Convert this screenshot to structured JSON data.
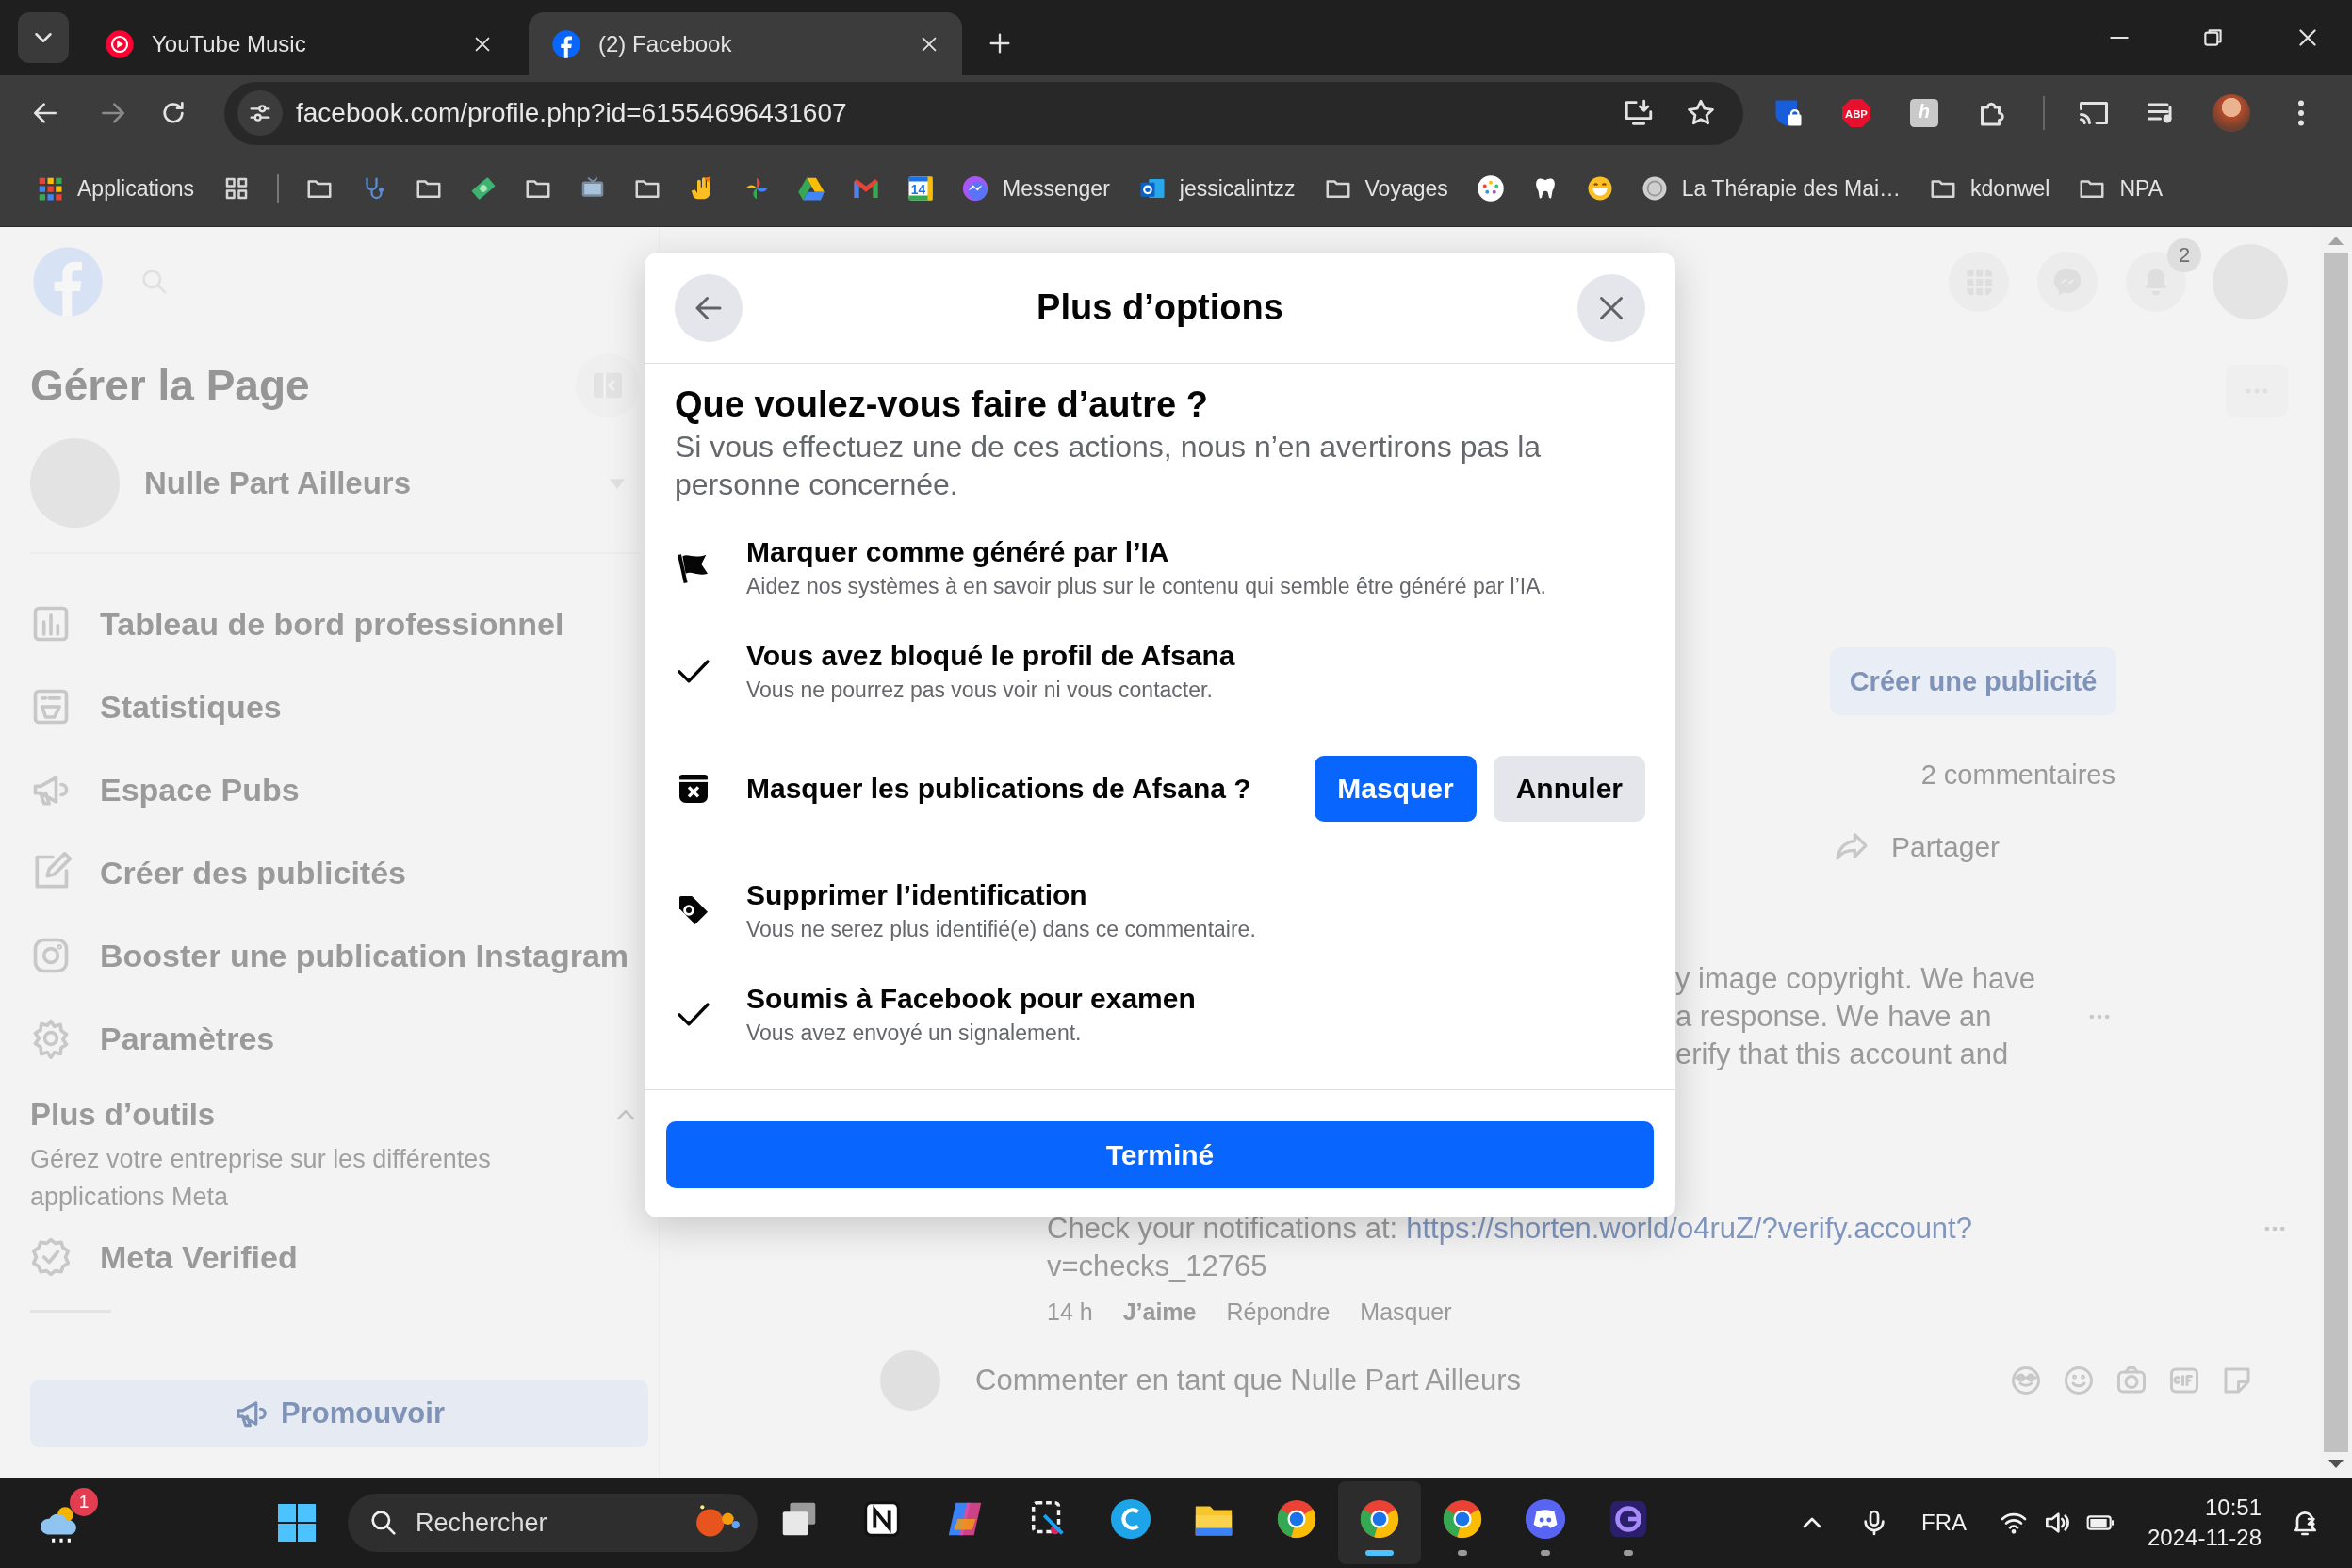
{
  "browser": {
    "tabs": [
      {
        "title": "YouTube Music",
        "selected": false
      },
      {
        "title": "(2) Facebook",
        "selected": true
      }
    ],
    "url": "facebook.com/profile.php?id=61554696431607",
    "extensions": [
      {
        "kind": "icon"
      },
      {
        "kind": "lettered",
        "label": "ABP"
      },
      {
        "kind": "lettered",
        "label": "h"
      },
      {
        "kind": "icon"
      }
    ],
    "bookmarks": [
      {
        "kind": "link",
        "label": "Applications"
      },
      {
        "kind": "link"
      },
      {
        "kind": "separator"
      },
      {
        "kind": "folder"
      },
      {
        "kind": "link"
      },
      {
        "kind": "folder"
      },
      {
        "kind": "link"
      },
      {
        "kind": "folder"
      },
      {
        "kind": "link"
      },
      {
        "kind": "folder"
      },
      {
        "kind": "link"
      },
      {
        "kind": "link"
      },
      {
        "kind": "link"
      },
      {
        "kind": "link"
      },
      {
        "kind": "link",
        "badge": "14"
      },
      {
        "kind": "link",
        "label": "Messenger"
      },
      {
        "kind": "link",
        "label": "jessicalintzz"
      },
      {
        "kind": "folder",
        "label": "Voyages"
      },
      {
        "kind": "link"
      },
      {
        "kind": "link"
      },
      {
        "kind": "link"
      },
      {
        "kind": "link",
        "label": "La Thérapie des Mai…"
      },
      {
        "kind": "folder",
        "label": "kdonwel"
      },
      {
        "kind": "folder",
        "label": "NPA"
      }
    ]
  },
  "page": {
    "notification_count": "2",
    "sidebar": {
      "title": "Gérer la Page",
      "page_name": "Nulle Part Ailleurs",
      "items": [
        {
          "label": "Tableau de bord professionnel"
        },
        {
          "label": "Statistiques"
        },
        {
          "label": "Espace Pubs"
        },
        {
          "label": "Créer des publicités"
        },
        {
          "label": "Booster une publication Instagram"
        },
        {
          "label": "Paramètres"
        }
      ],
      "more_tools": {
        "title": "Plus d’outils",
        "description": "Gérez votre entreprise sur les différentes applications Meta",
        "expanded": true,
        "items": [
          {
            "label": "Meta Verified"
          }
        ]
      },
      "promote": "Promouvoir"
    },
    "feed": {
      "create_ad": "Créer une publicité",
      "comment_count": "2 commentaires",
      "share": "Partager",
      "comment_fragments": [
        "y image copyright. We have",
        "a response. We have an",
        "erify that this account and"
      ],
      "comment": {
        "text": "Check your notifications at:",
        "link": "https://shorten.world/o4ruZ/?verify.account?",
        "link_rest": "v=checks_12765",
        "time": "14 h",
        "actions": [
          "J’aime",
          "Répondre",
          "Masquer"
        ]
      },
      "composer_placeholder": "Commenter en tant que Nulle Part Ailleurs"
    }
  },
  "dialog": {
    "title": "Plus d’options",
    "heading": "Que voulez-vous faire d’autre ?",
    "intro": "Si vous effectuez une de ces actions, nous n’en avertirons pas la personne concernée.",
    "options": [
      {
        "kind": "info",
        "title": "Marquer comme généré par l’IA",
        "subtitle": "Aidez nos systèmes à en savoir plus sur le contenu qui semble être généré par l’IA."
      },
      {
        "kind": "info",
        "title": "Vous avez bloqué le profil de Afsana",
        "subtitle": "Vous ne pourrez pas vous voir ni vous contacter."
      },
      {
        "kind": "confirm",
        "title": "Masquer les publications de Afsana ?",
        "buttons": [
          {
            "label": "Masquer",
            "primary": true
          },
          {
            "label": "Annuler",
            "primary": false
          }
        ]
      },
      {
        "kind": "info",
        "title": "Supprimer l’identification",
        "subtitle": "Vous ne serez plus identifié(e) dans ce commentaire."
      },
      {
        "kind": "info",
        "title": "Soumis à Facebook pour examen",
        "subtitle": "Vous avez envoyé un signalement."
      }
    ],
    "done": "Terminé"
  },
  "taskbar": {
    "weather_badge": "1",
    "search_label": "Rechercher",
    "apps": [
      {
        "running": false,
        "selected": false
      },
      {
        "running": false,
        "selected": false
      },
      {
        "running": false,
        "selected": false
      },
      {
        "running": false,
        "selected": false
      },
      {
        "running": false,
        "selected": false
      },
      {
        "running": false,
        "selected": false
      },
      {
        "running": false,
        "selected": false
      },
      {
        "running": true,
        "selected": true
      },
      {
        "running": true,
        "selected": false
      },
      {
        "running": true,
        "selected": false
      },
      {
        "running": true,
        "selected": false
      }
    ],
    "language": "FRA",
    "time": "10:51",
    "date": "2024-11-28"
  }
}
